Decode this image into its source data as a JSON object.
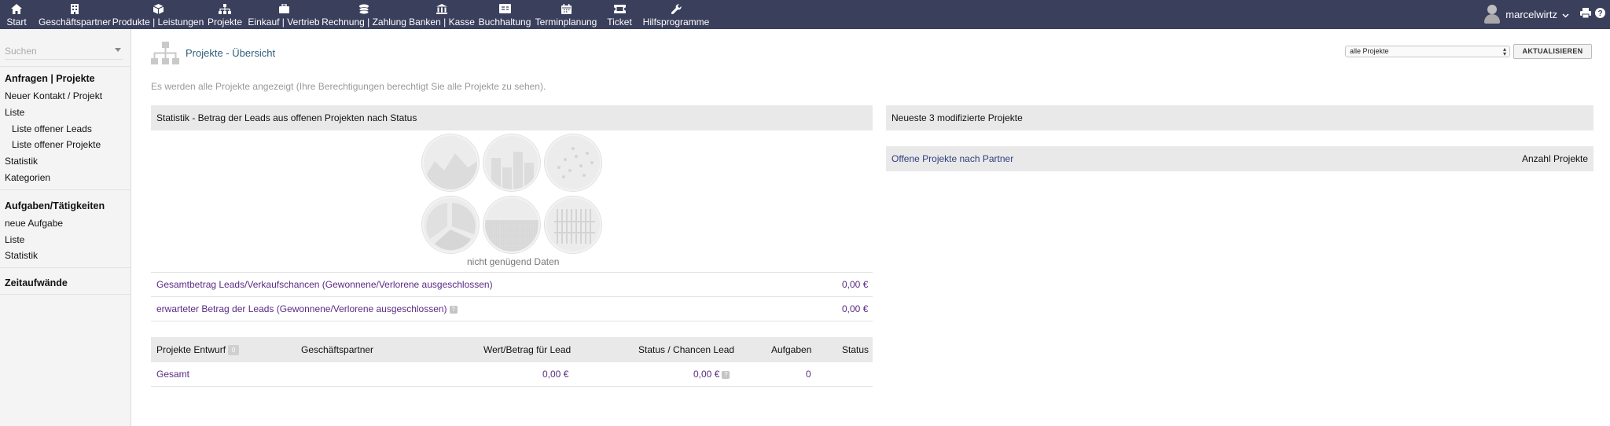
{
  "nav": {
    "items": [
      {
        "label": "Start",
        "icon": "home-icon"
      },
      {
        "label": "Geschäftspartner",
        "icon": "building-icon"
      },
      {
        "label": "Produkte | Leistungen",
        "icon": "box-icon"
      },
      {
        "label": "Projekte",
        "icon": "sitemap-icon"
      },
      {
        "label": "Einkauf | Vertrieb",
        "icon": "briefcase-icon"
      },
      {
        "label": "Rechnung | Zahlung",
        "icon": "coins-icon"
      },
      {
        "label": "Banken | Kasse",
        "icon": "bank-icon"
      },
      {
        "label": "Buchhaltung",
        "icon": "ledger-icon"
      },
      {
        "label": "Terminplanung",
        "icon": "calendar-icon"
      },
      {
        "label": "Ticket",
        "icon": "ticket-icon"
      },
      {
        "label": "Hilfsprogramme",
        "icon": "wrench-icon"
      }
    ],
    "active": "Projekte",
    "user": "marcelwirtz"
  },
  "sidebar": {
    "search_placeholder": "Suchen",
    "section1": "Anfragen | Projekte",
    "new_contact": "Neuer Kontakt / Projekt",
    "list": "Liste",
    "open_leads": "Liste offener Leads",
    "open_projects": "Liste offener Projekte",
    "statistics": "Statistik",
    "categories": "Kategorien",
    "section2": "Aufgaben/Tätigkeiten",
    "new_task": "neue Aufgabe",
    "task_list": "Liste",
    "task_statistics": "Statistik",
    "section3": "Zeitaufwände"
  },
  "header": {
    "title": "Projekte - Übersicht",
    "filter_value": "alle Projekte",
    "refresh_label": "AKTUALISIEREN",
    "info": "Es werden alle Projekte angezeigt (Ihre Berechtigungen berechtigt Sie alle Projekte zu sehen)."
  },
  "stats_panel": {
    "title": "Statistik - Betrag der Leads aus offenen Projekten nach Status",
    "no_data": "nicht genügend Daten",
    "row1_label": "Gesamtbetrag Leads/Verkaufschancen (Gewonnene/Verlorene ausgeschlossen)",
    "row1_value": "0,00 €",
    "row2_label": "erwarteter Betrag der Leads (Gewonnene/Verlorene ausgeschlossen)",
    "row2_value": "0,00 €"
  },
  "draft_table": {
    "headers": {
      "project": "Projekte Entwurf",
      "count": "0",
      "partner": "Geschäftspartner",
      "value": "Wert/Betrag für Lead",
      "status_chance": "Status / Chancen Lead",
      "tasks": "Aufgaben",
      "status": "Status"
    },
    "total_row": {
      "label": "Gesamt",
      "value": "0,00 €",
      "status_chance": "0,00 €",
      "tasks": "0"
    }
  },
  "recent_panel": {
    "title": "Neueste 3 modifizierte Projekte",
    "open_by_partner": "Offene Projekte nach Partner",
    "count_header": "Anzahl Projekte"
  },
  "colors": {
    "nav_bg": "#3a3f5c",
    "link_purple": "#5b2a86",
    "title_teal": "#2f5f7a",
    "panel_bg": "#e9e9ea"
  }
}
